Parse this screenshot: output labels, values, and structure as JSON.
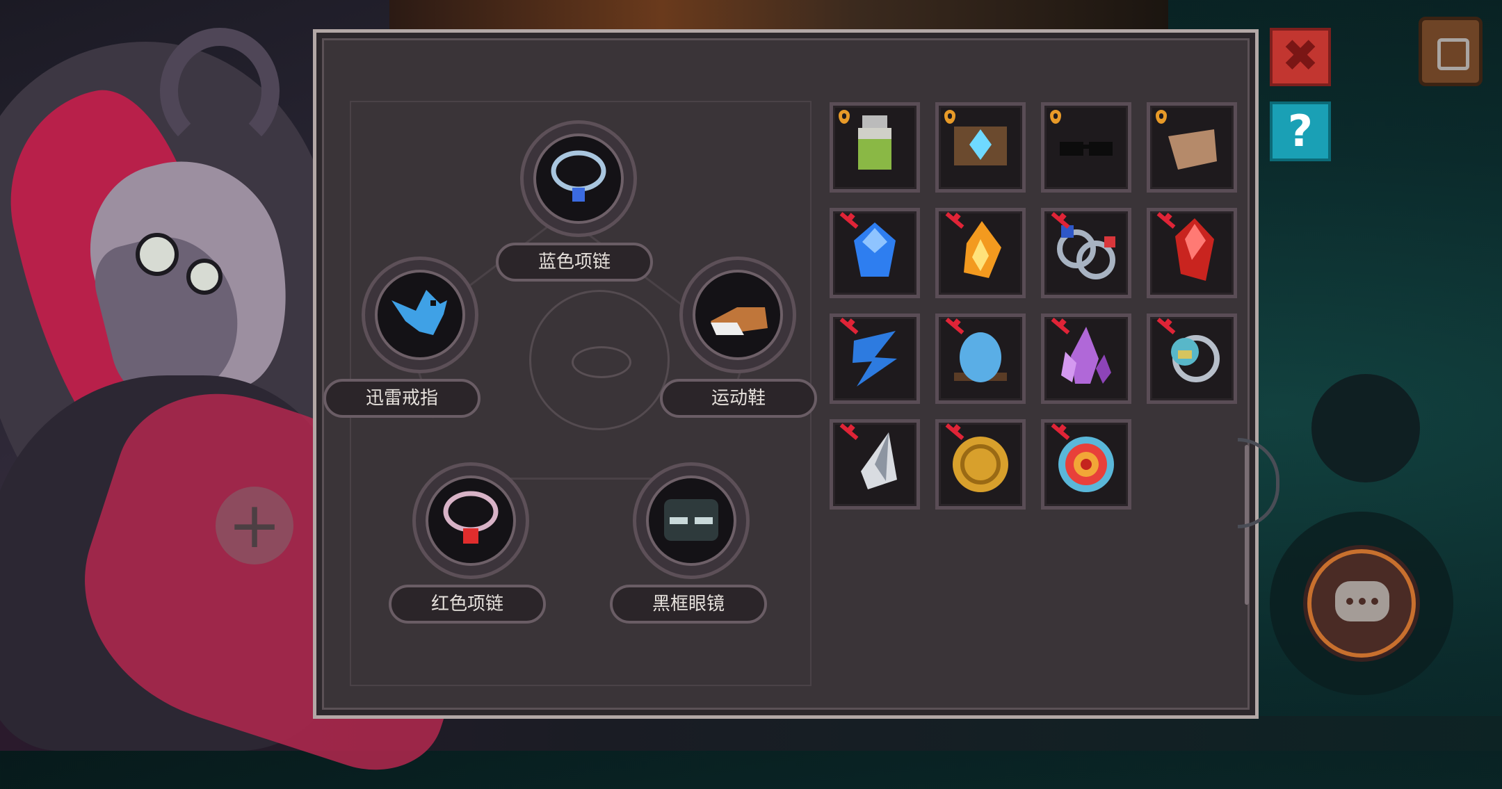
{
  "tree": {
    "nodes": [
      {
        "label": "蓝色项链",
        "icon": "blue-necklace-icon"
      },
      {
        "label": "迅雷戒指",
        "icon": "blue-bird-icon"
      },
      {
        "label": "运动鞋",
        "icon": "sneaker-icon"
      },
      {
        "label": "红色项链",
        "icon": "red-necklace-icon"
      },
      {
        "label": "黑框眼镜",
        "icon": "black-glasses-icon"
      }
    ]
  },
  "grid": {
    "items": [
      {
        "icon": "green-potion-icon",
        "status": "locked"
      },
      {
        "icon": "crystal-altar-icon",
        "status": "locked"
      },
      {
        "icon": "black-glasses-item-icon",
        "status": "locked"
      },
      {
        "icon": "leather-glove-icon",
        "status": "locked"
      },
      {
        "icon": "blue-gem-icon",
        "status": "unavailable"
      },
      {
        "icon": "fire-crystal-icon",
        "status": "unavailable"
      },
      {
        "icon": "twin-rings-icon",
        "status": "unavailable"
      },
      {
        "icon": "red-crystal-icon",
        "status": "unavailable"
      },
      {
        "icon": "lightning-boot-icon",
        "status": "unavailable"
      },
      {
        "icon": "blue-egg-icon",
        "status": "unavailable"
      },
      {
        "icon": "purple-crystal-icon",
        "status": "unavailable"
      },
      {
        "icon": "globe-ring-icon",
        "status": "unavailable"
      },
      {
        "icon": "silver-horn-icon",
        "status": "unavailable"
      },
      {
        "icon": "gold-coin-icon",
        "status": "unavailable"
      },
      {
        "icon": "target-badge-icon",
        "status": "unavailable"
      }
    ]
  },
  "hud": {
    "close": "✖",
    "help": "?"
  },
  "colors": {
    "panel": "#3a3438",
    "lock": "#e89a28",
    "unavailable": "#e02437",
    "close": "#c23630",
    "help": "#1aa0b5"
  }
}
